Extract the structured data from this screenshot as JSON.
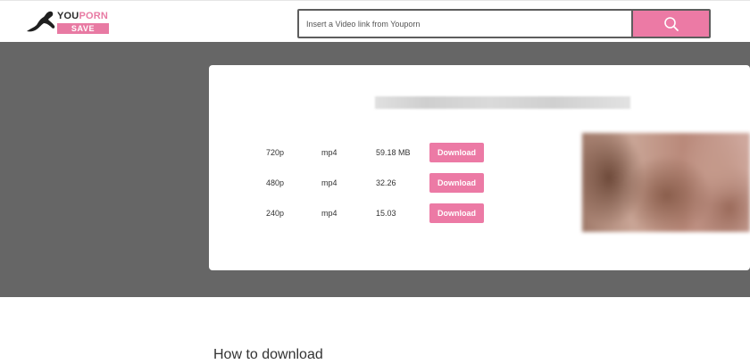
{
  "header": {
    "logo": {
      "word_you": "YOU",
      "word_porn": "PORN",
      "word_save": "SAVE"
    },
    "search": {
      "placeholder": "Insert a Video link from Youporn",
      "value": "",
      "button_icon": "search-icon"
    }
  },
  "result": {
    "formats": [
      {
        "resolution": "720p",
        "container": "mp4",
        "size": "59.18 MB",
        "action_label": "Download"
      },
      {
        "resolution": "480p",
        "container": "mp4",
        "size": "32.26",
        "action_label": "Download"
      },
      {
        "resolution": "240p",
        "container": "mp4",
        "size": "15.03",
        "action_label": "Download"
      }
    ]
  },
  "info": {
    "heading": "How to download"
  },
  "colors": {
    "accent": "#ec7aa5",
    "band": "#666666",
    "frame": "#5d5d5d"
  }
}
